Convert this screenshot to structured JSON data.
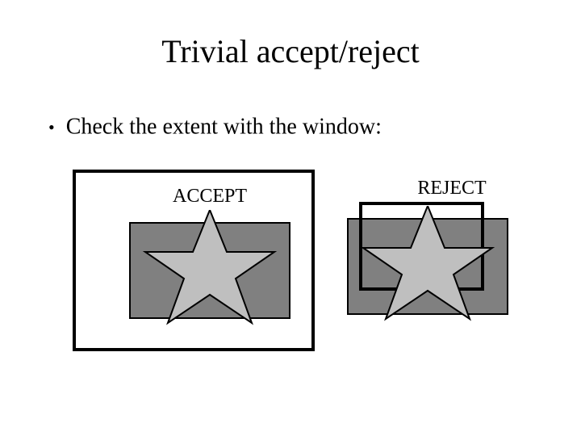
{
  "title": "Trivial accept/reject",
  "bullet1": "Check the extent with the window:",
  "labels": {
    "accept": "ACCEPT",
    "reject": "REJECT"
  },
  "colors": {
    "bbox_fill": "#808080",
    "star_fill": "#bfbfbf",
    "stroke": "#000000"
  }
}
